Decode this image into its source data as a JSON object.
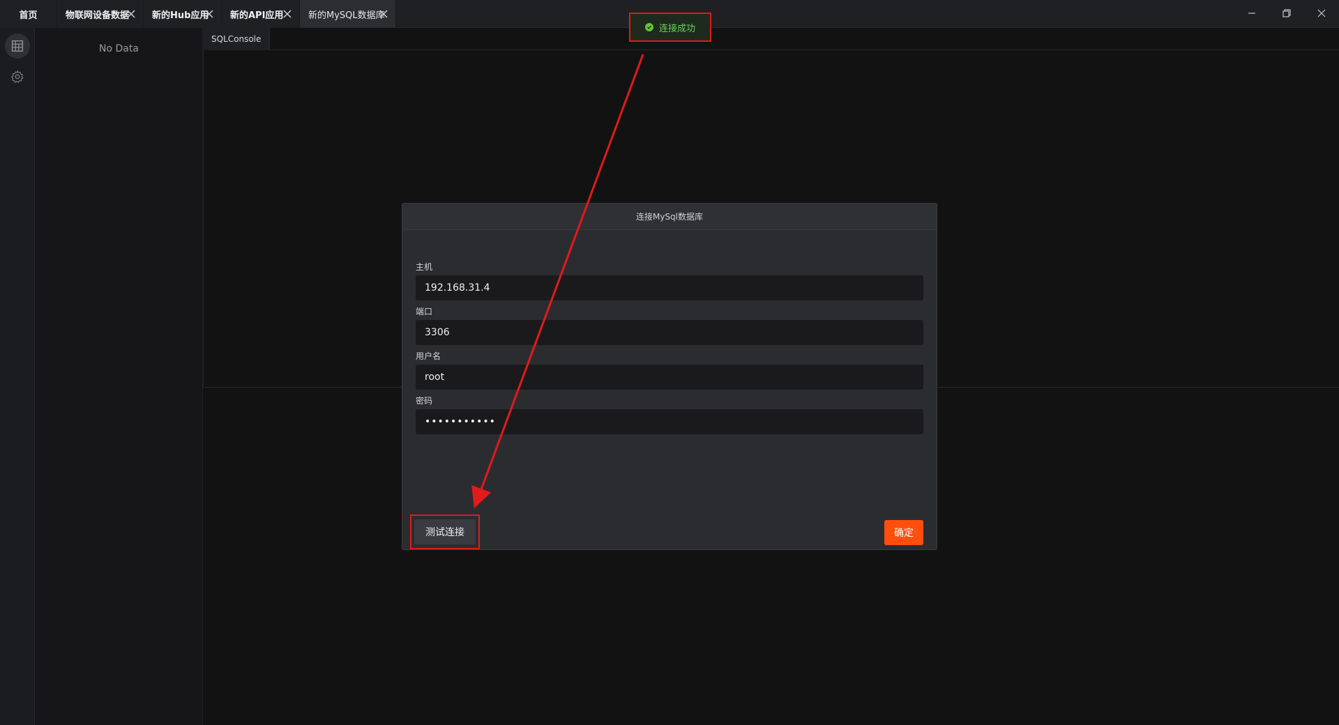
{
  "tabs": [
    {
      "label": "首页",
      "closable": false,
      "active": false
    },
    {
      "label": "物联网设备数据",
      "closable": true,
      "active": false
    },
    {
      "label": "新的Hub应用",
      "closable": true,
      "active": false
    },
    {
      "label": "新的API应用",
      "closable": true,
      "active": false
    },
    {
      "label": "新的MySQL数据库",
      "closable": true,
      "active": true
    }
  ],
  "window_controls": [
    "minimize-icon",
    "restore-icon",
    "close-icon"
  ],
  "rail": [
    {
      "icon": "database-icon",
      "active": true
    },
    {
      "icon": "gear-icon",
      "active": false
    }
  ],
  "side_panel": {
    "empty_text": "No Data"
  },
  "main": {
    "tabs": [
      {
        "label": "SQLConsole"
      }
    ]
  },
  "toast": {
    "text": "连接成功",
    "color": "#67c23a"
  },
  "dialog": {
    "title": "连接MySql数据库",
    "fields": {
      "host": {
        "label": "主机",
        "value": "192.168.31.4"
      },
      "port": {
        "label": "端口",
        "value": "3306"
      },
      "username": {
        "label": "用户名",
        "value": "root"
      },
      "password": {
        "label": "密码",
        "value": "•••••••••••"
      }
    },
    "buttons": {
      "test": "测试连接",
      "confirm": "确定"
    }
  },
  "colors": {
    "accent": "#ff4e0d",
    "annotation": "#e11a1a",
    "success": "#67c23a"
  }
}
